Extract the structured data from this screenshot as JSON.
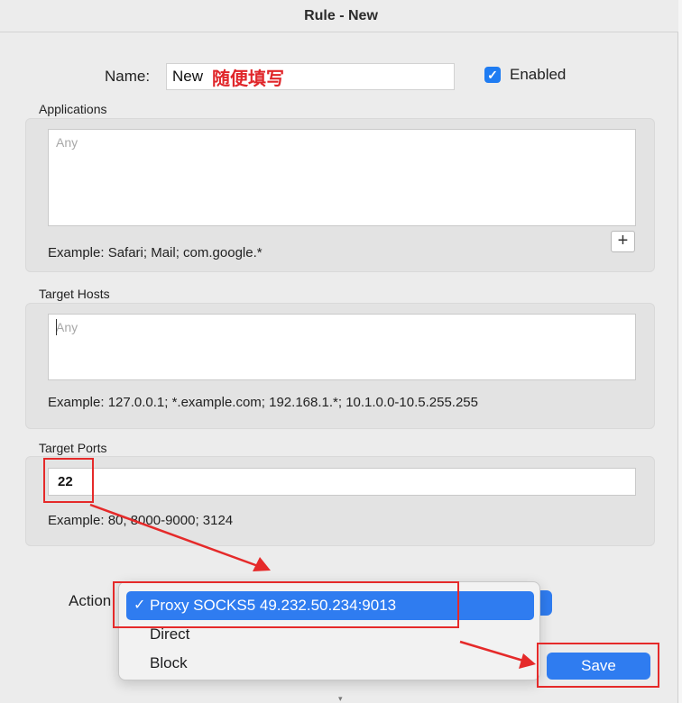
{
  "window": {
    "title": "Rule - New"
  },
  "name": {
    "label": "Name:",
    "value": "New",
    "annotation": "随便填写"
  },
  "enabled": {
    "label": "Enabled",
    "checked": true,
    "check_glyph": "✓"
  },
  "applications": {
    "label": "Applications",
    "placeholder": "Any",
    "example": "Example: Safari; Mail; com.google.*",
    "add_button": "+"
  },
  "target_hosts": {
    "label": "Target Hosts",
    "placeholder": "Any",
    "example": "Example: 127.0.0.1; *.example.com; 192.168.1.*; 10.1.0.0-10.5.255.255"
  },
  "target_ports": {
    "label": "Target Ports",
    "value": "22",
    "example": "Example: 80; 8000-9000; 3124"
  },
  "action": {
    "label": "Action",
    "selected": "Proxy SOCKS5 49.232.50.234:9013",
    "options": [
      "Proxy SOCKS5 49.232.50.234:9013",
      "Direct",
      "Block"
    ],
    "check_glyph": "✓"
  },
  "save_button": {
    "label": "Save"
  },
  "colors": {
    "accent": "#2f7cf0",
    "annotation_red": "#e52a2a"
  }
}
